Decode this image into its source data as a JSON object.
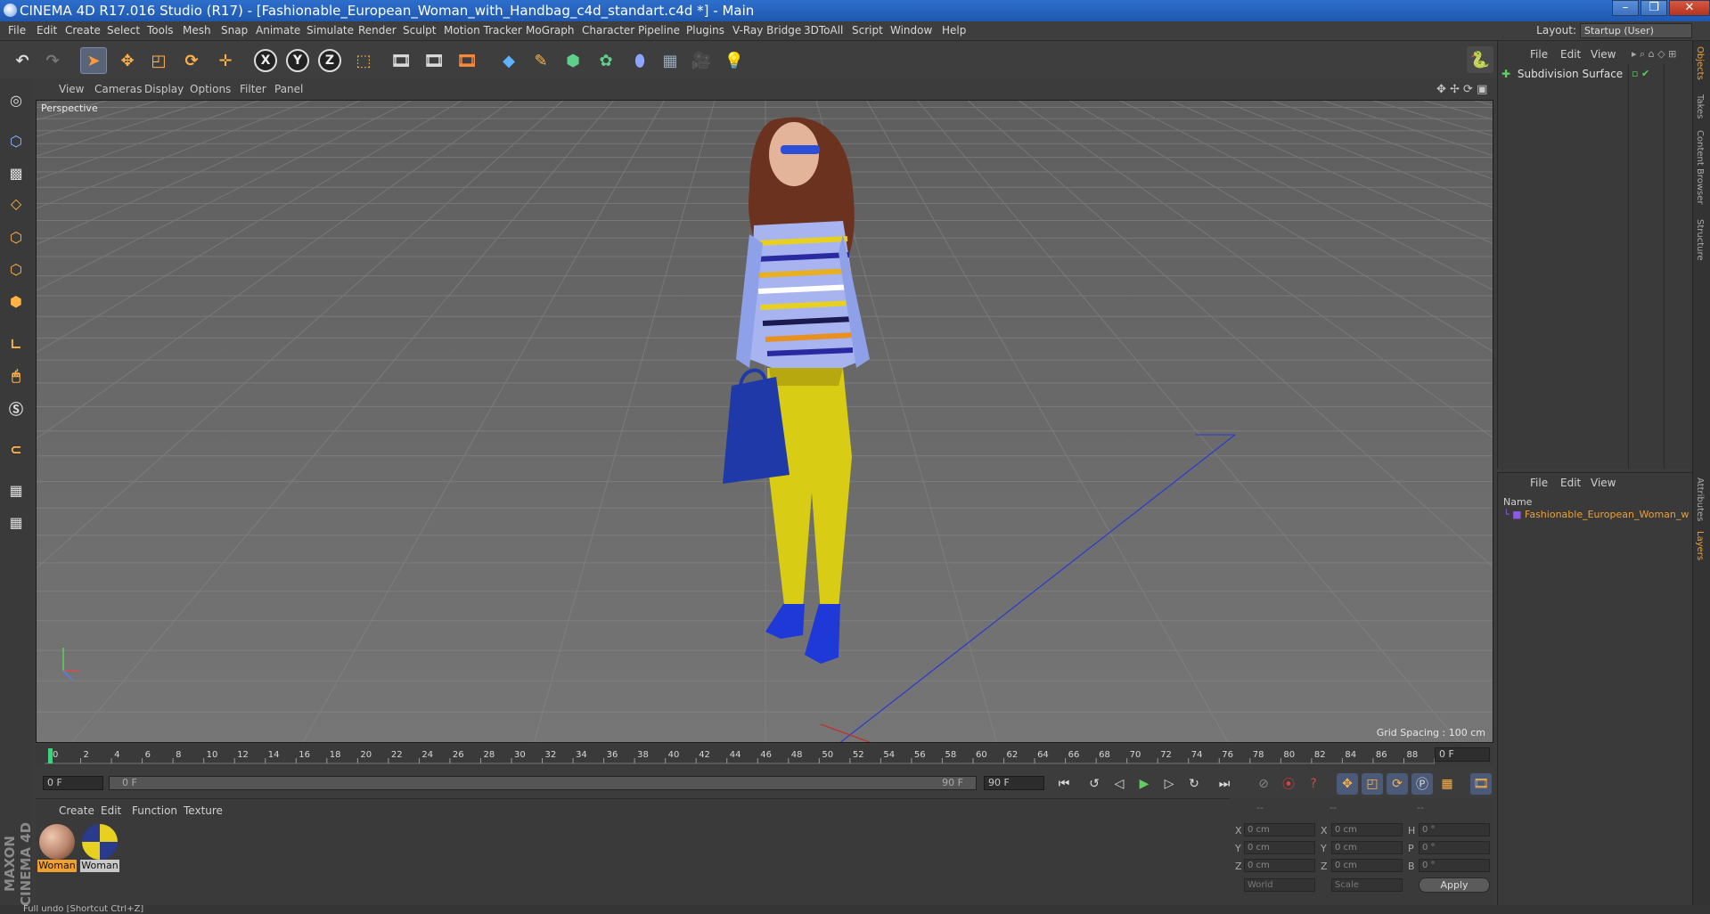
{
  "window": {
    "title": "CINEMA 4D R17.016 Studio (R17) - [Fashionable_European_Woman_with_Handbag_c4d_standart.c4d *] - Main",
    "minimize": "–",
    "maximize": "❐",
    "close": "✕"
  },
  "menu": {
    "items": [
      "File",
      "Edit",
      "Create",
      "Select",
      "Tools",
      "Mesh",
      "Snap",
      "Animate",
      "Simulate",
      "Render",
      "Sculpt",
      "Motion Tracker",
      "MoGraph",
      "Character",
      "Pipeline",
      "Plugins",
      "V-Ray Bridge",
      "3DToAll",
      "Script",
      "Window",
      "Help"
    ],
    "layout_label": "Layout:",
    "layout_value": "Startup (User)"
  },
  "toolbar": {
    "axis_x": "X",
    "axis_y": "Y",
    "axis_z": "Z"
  },
  "viewport": {
    "menu": [
      "View",
      "Cameras",
      "Display",
      "Options",
      "Filter",
      "Panel"
    ],
    "camera_label": "Perspective",
    "grid_spacing": "Grid Spacing : 100 cm"
  },
  "timeline": {
    "ticks": [
      "0",
      "2",
      "4",
      "6",
      "8",
      "10",
      "12",
      "14",
      "16",
      "18",
      "20",
      "22",
      "24",
      "26",
      "28",
      "30",
      "32",
      "34",
      "36",
      "38",
      "40",
      "42",
      "44",
      "46",
      "48",
      "50",
      "52",
      "54",
      "56",
      "58",
      "60",
      "62",
      "64",
      "66",
      "68",
      "70",
      "72",
      "74",
      "76",
      "78",
      "80",
      "82",
      "84",
      "86",
      "88",
      "90"
    ],
    "current_frame": "0 F",
    "start_frame": "0 F",
    "slider_start": "0 F",
    "slider_end": "90 F",
    "end_frame": "90 F"
  },
  "material_manager": {
    "menu": [
      "Create",
      "Edit",
      "Function",
      "Texture"
    ],
    "materials": [
      {
        "name": "Woman",
        "color": "#b8826a"
      },
      {
        "name": "Woman",
        "color": "#2a3a8c"
      }
    ]
  },
  "attributes": {
    "header": [
      "--",
      "--",
      "--"
    ],
    "rows": [
      {
        "a": "X",
        "v1": "0 cm",
        "b": "X",
        "v2": "0 cm",
        "c": "H",
        "v3": "0 °"
      },
      {
        "a": "Y",
        "v1": "0 cm",
        "b": "Y",
        "v2": "0 cm",
        "c": "P",
        "v3": "0 °"
      },
      {
        "a": "Z",
        "v1": "0 cm",
        "b": "Z",
        "v2": "0 cm",
        "c": "B",
        "v3": "0 °"
      }
    ],
    "coord_mode": "World",
    "size_mode": "Scale",
    "apply": "Apply"
  },
  "objects_panel": {
    "menu": [
      "File",
      "Edit",
      "View"
    ],
    "object": "Subdivision Surface"
  },
  "layers_panel": {
    "menu": [
      "File",
      "Edit",
      "View"
    ],
    "column": "Name",
    "layer": "Fashionable_European_Woman_w"
  },
  "side_tabs": [
    "Objects",
    "Takes",
    "Content Browser",
    "Structure",
    "Attributes",
    "Layers"
  ],
  "brand": "MAXON CINEMA 4D",
  "status": "Full undo [Shortcut Ctrl+Z]"
}
